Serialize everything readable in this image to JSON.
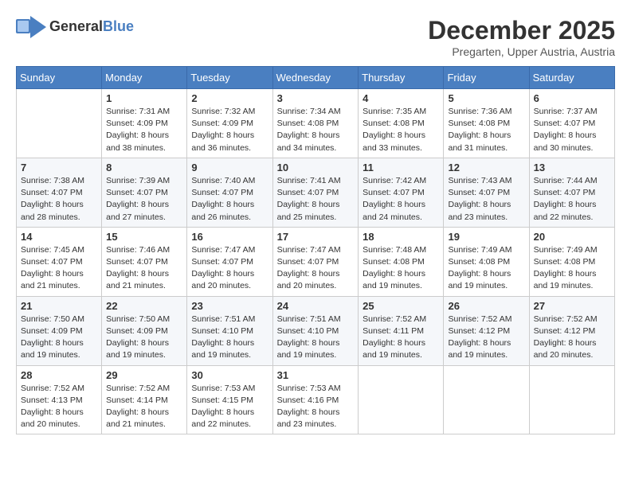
{
  "header": {
    "logo_general": "General",
    "logo_blue": "Blue",
    "month_title": "December 2025",
    "location": "Pregarten, Upper Austria, Austria"
  },
  "weekdays": [
    "Sunday",
    "Monday",
    "Tuesday",
    "Wednesday",
    "Thursday",
    "Friday",
    "Saturday"
  ],
  "weeks": [
    [
      {
        "day": "",
        "sunrise": "",
        "sunset": "",
        "daylight": ""
      },
      {
        "day": "1",
        "sunrise": "Sunrise: 7:31 AM",
        "sunset": "Sunset: 4:09 PM",
        "daylight": "Daylight: 8 hours and 38 minutes."
      },
      {
        "day": "2",
        "sunrise": "Sunrise: 7:32 AM",
        "sunset": "Sunset: 4:09 PM",
        "daylight": "Daylight: 8 hours and 36 minutes."
      },
      {
        "day": "3",
        "sunrise": "Sunrise: 7:34 AM",
        "sunset": "Sunset: 4:08 PM",
        "daylight": "Daylight: 8 hours and 34 minutes."
      },
      {
        "day": "4",
        "sunrise": "Sunrise: 7:35 AM",
        "sunset": "Sunset: 4:08 PM",
        "daylight": "Daylight: 8 hours and 33 minutes."
      },
      {
        "day": "5",
        "sunrise": "Sunrise: 7:36 AM",
        "sunset": "Sunset: 4:08 PM",
        "daylight": "Daylight: 8 hours and 31 minutes."
      },
      {
        "day": "6",
        "sunrise": "Sunrise: 7:37 AM",
        "sunset": "Sunset: 4:07 PM",
        "daylight": "Daylight: 8 hours and 30 minutes."
      }
    ],
    [
      {
        "day": "7",
        "sunrise": "Sunrise: 7:38 AM",
        "sunset": "Sunset: 4:07 PM",
        "daylight": "Daylight: 8 hours and 28 minutes."
      },
      {
        "day": "8",
        "sunrise": "Sunrise: 7:39 AM",
        "sunset": "Sunset: 4:07 PM",
        "daylight": "Daylight: 8 hours and 27 minutes."
      },
      {
        "day": "9",
        "sunrise": "Sunrise: 7:40 AM",
        "sunset": "Sunset: 4:07 PM",
        "daylight": "Daylight: 8 hours and 26 minutes."
      },
      {
        "day": "10",
        "sunrise": "Sunrise: 7:41 AM",
        "sunset": "Sunset: 4:07 PM",
        "daylight": "Daylight: 8 hours and 25 minutes."
      },
      {
        "day": "11",
        "sunrise": "Sunrise: 7:42 AM",
        "sunset": "Sunset: 4:07 PM",
        "daylight": "Daylight: 8 hours and 24 minutes."
      },
      {
        "day": "12",
        "sunrise": "Sunrise: 7:43 AM",
        "sunset": "Sunset: 4:07 PM",
        "daylight": "Daylight: 8 hours and 23 minutes."
      },
      {
        "day": "13",
        "sunrise": "Sunrise: 7:44 AM",
        "sunset": "Sunset: 4:07 PM",
        "daylight": "Daylight: 8 hours and 22 minutes."
      }
    ],
    [
      {
        "day": "14",
        "sunrise": "Sunrise: 7:45 AM",
        "sunset": "Sunset: 4:07 PM",
        "daylight": "Daylight: 8 hours and 21 minutes."
      },
      {
        "day": "15",
        "sunrise": "Sunrise: 7:46 AM",
        "sunset": "Sunset: 4:07 PM",
        "daylight": "Daylight: 8 hours and 21 minutes."
      },
      {
        "day": "16",
        "sunrise": "Sunrise: 7:47 AM",
        "sunset": "Sunset: 4:07 PM",
        "daylight": "Daylight: 8 hours and 20 minutes."
      },
      {
        "day": "17",
        "sunrise": "Sunrise: 7:47 AM",
        "sunset": "Sunset: 4:07 PM",
        "daylight": "Daylight: 8 hours and 20 minutes."
      },
      {
        "day": "18",
        "sunrise": "Sunrise: 7:48 AM",
        "sunset": "Sunset: 4:08 PM",
        "daylight": "Daylight: 8 hours and 19 minutes."
      },
      {
        "day": "19",
        "sunrise": "Sunrise: 7:49 AM",
        "sunset": "Sunset: 4:08 PM",
        "daylight": "Daylight: 8 hours and 19 minutes."
      },
      {
        "day": "20",
        "sunrise": "Sunrise: 7:49 AM",
        "sunset": "Sunset: 4:08 PM",
        "daylight": "Daylight: 8 hours and 19 minutes."
      }
    ],
    [
      {
        "day": "21",
        "sunrise": "Sunrise: 7:50 AM",
        "sunset": "Sunset: 4:09 PM",
        "daylight": "Daylight: 8 hours and 19 minutes."
      },
      {
        "day": "22",
        "sunrise": "Sunrise: 7:50 AM",
        "sunset": "Sunset: 4:09 PM",
        "daylight": "Daylight: 8 hours and 19 minutes."
      },
      {
        "day": "23",
        "sunrise": "Sunrise: 7:51 AM",
        "sunset": "Sunset: 4:10 PM",
        "daylight": "Daylight: 8 hours and 19 minutes."
      },
      {
        "day": "24",
        "sunrise": "Sunrise: 7:51 AM",
        "sunset": "Sunset: 4:10 PM",
        "daylight": "Daylight: 8 hours and 19 minutes."
      },
      {
        "day": "25",
        "sunrise": "Sunrise: 7:52 AM",
        "sunset": "Sunset: 4:11 PM",
        "daylight": "Daylight: 8 hours and 19 minutes."
      },
      {
        "day": "26",
        "sunrise": "Sunrise: 7:52 AM",
        "sunset": "Sunset: 4:12 PM",
        "daylight": "Daylight: 8 hours and 19 minutes."
      },
      {
        "day": "27",
        "sunrise": "Sunrise: 7:52 AM",
        "sunset": "Sunset: 4:12 PM",
        "daylight": "Daylight: 8 hours and 20 minutes."
      }
    ],
    [
      {
        "day": "28",
        "sunrise": "Sunrise: 7:52 AM",
        "sunset": "Sunset: 4:13 PM",
        "daylight": "Daylight: 8 hours and 20 minutes."
      },
      {
        "day": "29",
        "sunrise": "Sunrise: 7:52 AM",
        "sunset": "Sunset: 4:14 PM",
        "daylight": "Daylight: 8 hours and 21 minutes."
      },
      {
        "day": "30",
        "sunrise": "Sunrise: 7:53 AM",
        "sunset": "Sunset: 4:15 PM",
        "daylight": "Daylight: 8 hours and 22 minutes."
      },
      {
        "day": "31",
        "sunrise": "Sunrise: 7:53 AM",
        "sunset": "Sunset: 4:16 PM",
        "daylight": "Daylight: 8 hours and 23 minutes."
      },
      {
        "day": "",
        "sunrise": "",
        "sunset": "",
        "daylight": ""
      },
      {
        "day": "",
        "sunrise": "",
        "sunset": "",
        "daylight": ""
      },
      {
        "day": "",
        "sunrise": "",
        "sunset": "",
        "daylight": ""
      }
    ]
  ]
}
